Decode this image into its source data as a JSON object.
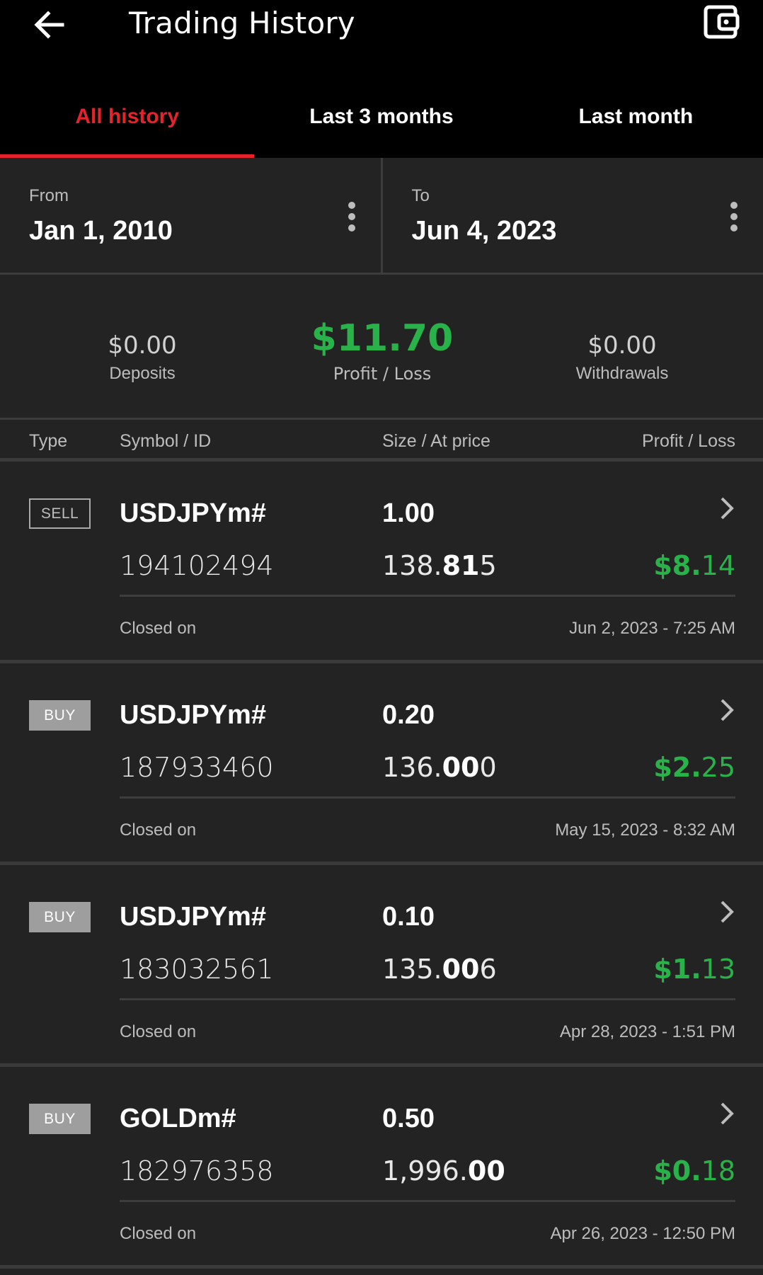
{
  "header": {
    "title": "Trading History",
    "back_icon": "arrow-left-icon",
    "wallet_icon": "wallet-icon"
  },
  "tabs": [
    {
      "label": "All history",
      "active": true
    },
    {
      "label": "Last 3 months",
      "active": false
    },
    {
      "label": "Last month",
      "active": false
    }
  ],
  "date_range": {
    "from_label": "From",
    "from_value": "Jan 1, 2010",
    "to_label": "To",
    "to_value": "Jun 4, 2023"
  },
  "summary": {
    "deposits_value": "$0.00",
    "deposits_label": "Deposits",
    "pl_value": "$11.70",
    "pl_label": "Profit / Loss",
    "withdrawals_value": "$0.00",
    "withdrawals_label": "Withdrawals"
  },
  "columns": {
    "type": "Type",
    "symbol": "Symbol / ID",
    "size": "Size / At price",
    "pl": "Profit / Loss"
  },
  "trades": [
    {
      "type": "SELL",
      "symbol": "USDJPYm#",
      "id": "194102494",
      "size": "1.00",
      "price_pre": "138.",
      "price_bold": "81",
      "price_post": "5",
      "pl_bold": "$8.",
      "pl_rest": "14",
      "closed_label": "Closed on",
      "closed_date": "Jun 2, 2023 - 7:25 AM"
    },
    {
      "type": "BUY",
      "symbol": "USDJPYm#",
      "id": "187933460",
      "size": "0.20",
      "price_pre": "136.",
      "price_bold": "00",
      "price_post": "0",
      "pl_bold": "$2.",
      "pl_rest": "25",
      "closed_label": "Closed on",
      "closed_date": "May 15, 2023 - 8:32 AM"
    },
    {
      "type": "BUY",
      "symbol": "USDJPYm#",
      "id": "183032561",
      "size": "0.10",
      "price_pre": "135.",
      "price_bold": "00",
      "price_post": "6",
      "pl_bold": "$1.",
      "pl_rest": "13",
      "closed_label": "Closed on",
      "closed_date": "Apr 28, 2023 - 1:51 PM"
    },
    {
      "type": "BUY",
      "symbol": "GOLDm#",
      "id": "182976358",
      "size": "0.50",
      "price_pre": "1,996.",
      "price_bold": "00",
      "price_post": "",
      "pl_bold": "$0.",
      "pl_rest": "18",
      "closed_label": "Closed on",
      "closed_date": "Apr 26, 2023 - 12:50 PM"
    }
  ],
  "colors": {
    "accent_red": "#e5232d",
    "profit_green": "#2ab24a",
    "background": "#232323",
    "header_bg": "#000000"
  }
}
